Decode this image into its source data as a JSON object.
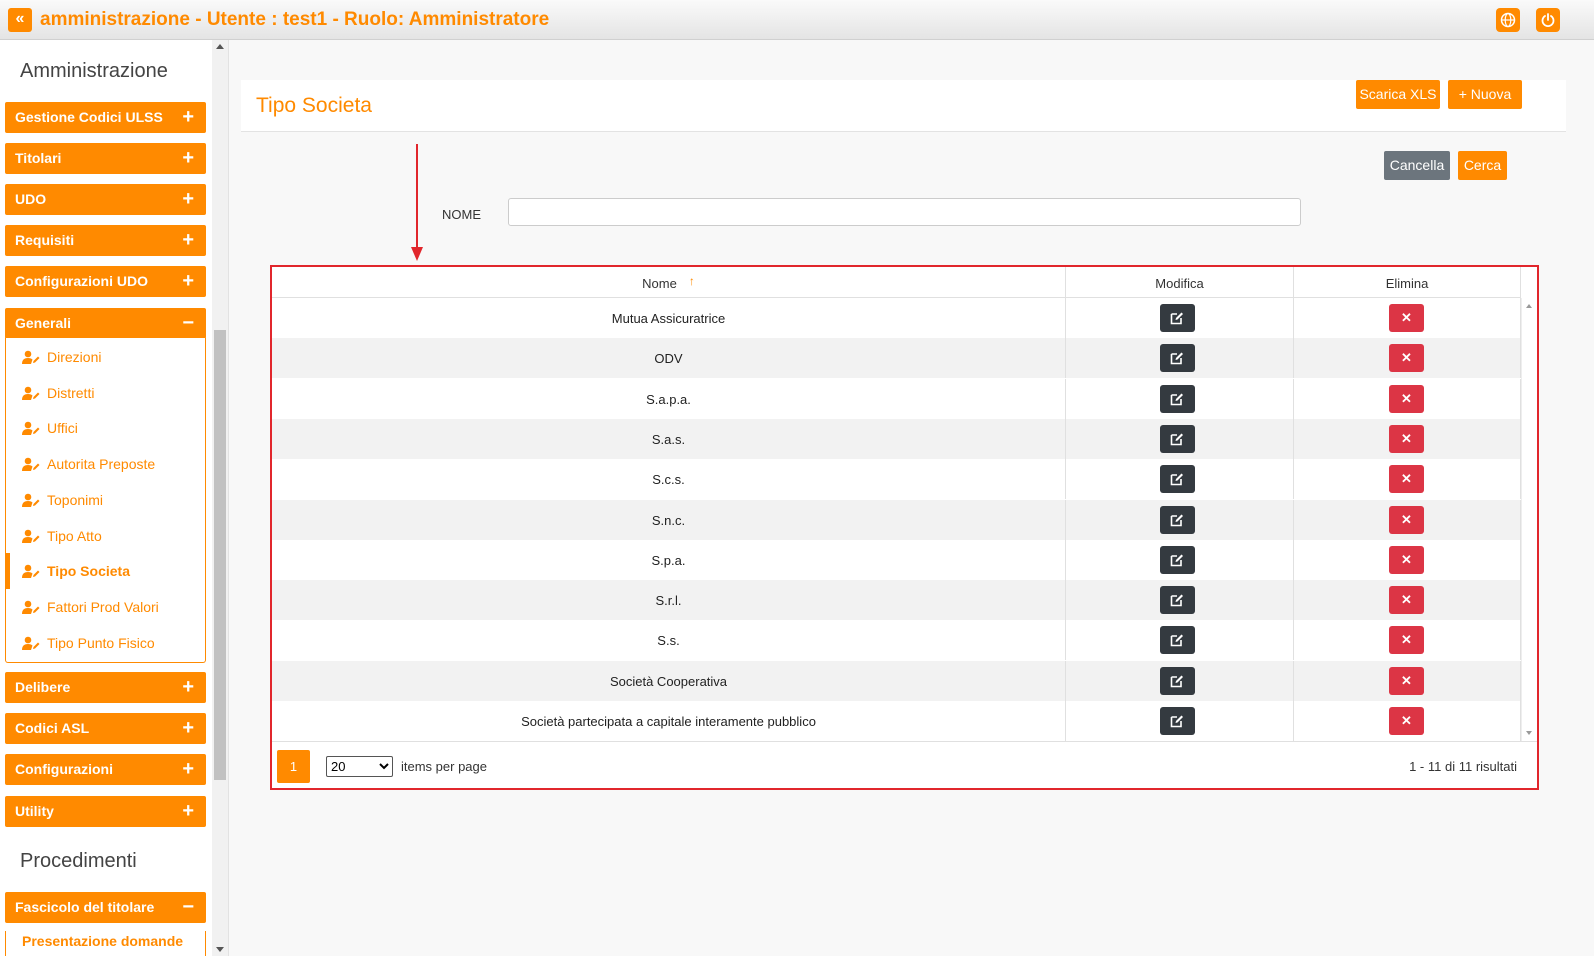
{
  "header": {
    "collapse_label": "«",
    "title": "amministrazione - Utente : test1 - Ruolo: Amministratore",
    "globe_icon": "globe-icon",
    "power_icon": "power-icon",
    "accent": "#ff8a00"
  },
  "sidebar": {
    "section1": "Amministrazione",
    "items": [
      {
        "label": "Gestione Codici ULSS",
        "sign": "+"
      },
      {
        "label": "Titolari",
        "sign": "+"
      },
      {
        "label": "UDO",
        "sign": "+"
      },
      {
        "label": "Requisiti",
        "sign": "+"
      },
      {
        "label": "Configurazioni UDO",
        "sign": "+"
      },
      {
        "label": "Generali",
        "sign": "−"
      }
    ],
    "generali_sub": [
      {
        "label": "Direzioni"
      },
      {
        "label": "Distretti"
      },
      {
        "label": "Uffici"
      },
      {
        "label": "Autorita Preposte"
      },
      {
        "label": "Toponimi"
      },
      {
        "label": "Tipo Atto"
      },
      {
        "label": "Tipo Societa"
      },
      {
        "label": "Fattori Prod Valori"
      },
      {
        "label": "Tipo Punto Fisico"
      }
    ],
    "items_after": [
      {
        "label": "Delibere",
        "sign": "+"
      },
      {
        "label": "Codici ASL",
        "sign": "+"
      },
      {
        "label": "Configurazioni",
        "sign": "+"
      },
      {
        "label": "Utility",
        "sign": "+"
      }
    ],
    "section2": "Procedimenti",
    "proc_item": {
      "label": "Fascicolo del titolare",
      "sign": "−"
    },
    "proc_sub_cut": "Presentazione domande"
  },
  "main": {
    "page_title": "Tipo Societa",
    "btn_xls": "Scarica XLS",
    "btn_new": "+ Nuova",
    "btn_cancel": "Cancella",
    "btn_search": "Cerca",
    "filter_label": "NOME",
    "filter_value": "",
    "filter_placeholder": ""
  },
  "grid": {
    "columns": [
      "Nome",
      "Modifica",
      "Elimina"
    ],
    "sort_icon": "↑",
    "rows": [
      "Mutua Assicuratrice",
      "ODV",
      "S.a.p.a.",
      "S.a.s.",
      "S.c.s.",
      "S.n.c.",
      "S.p.a.",
      "S.r.l.",
      "S.s.",
      "Società Cooperativa",
      "Società partecipata a capitale interamente pubblico"
    ],
    "delete_glyph": "✕",
    "page": "1",
    "page_size": "20",
    "page_size_options": [
      "20"
    ],
    "items_per_page": "items per page",
    "results": "1 - 11 di 11 risultati"
  }
}
